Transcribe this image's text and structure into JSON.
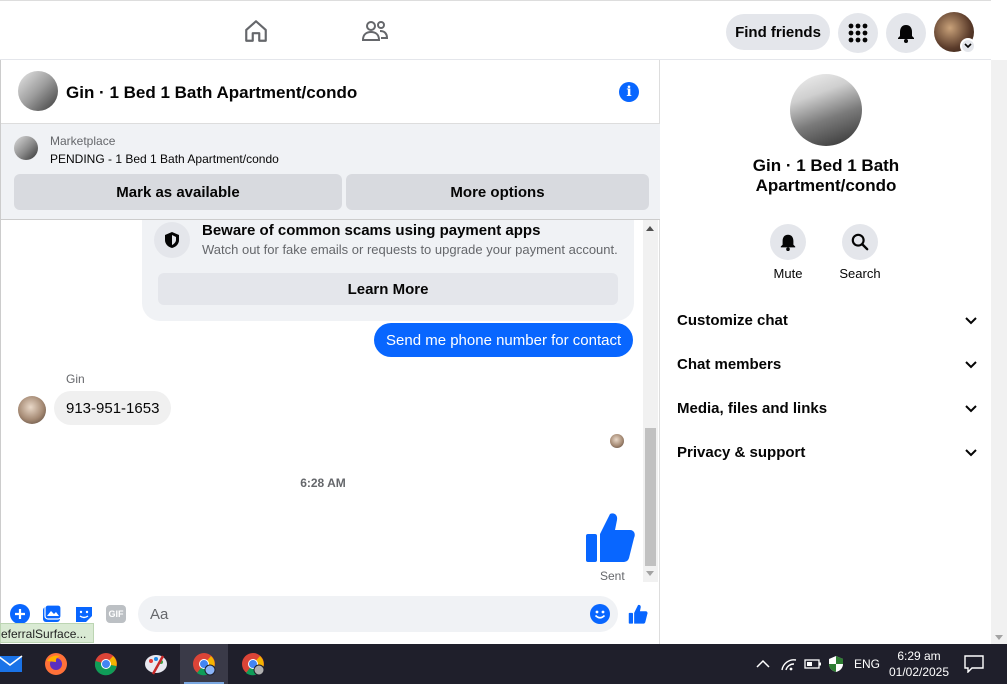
{
  "topnav": {
    "find_friends": "Find friends",
    "icons": [
      "home-icon",
      "friends-icon",
      "menu-grid-icon",
      "bell-icon",
      "profile-avatar"
    ]
  },
  "chat": {
    "title": "Gin · 1 Bed 1 Bath Apartment/condo",
    "marketplace_label": "Marketplace",
    "listing_status": "PENDING - 1 Bed 1 Bath Apartment/condo",
    "mark_available": "Mark as available",
    "more_options": "More options",
    "scam_title": "Beware of common scams using payment apps",
    "scam_body": "Watch out for fake emails or requests to upgrade your payment account.",
    "learn_more": "Learn More",
    "sent_message": "Send me phone number for contact",
    "sender_name": "Gin",
    "received_message": "913-951-1653",
    "timestamp": "6:28 AM",
    "sent_status": "Sent",
    "composer_placeholder": "Aa",
    "gif_label": "GIF"
  },
  "status_link": "eferralSurface...",
  "info_panel": {
    "title": "Gin · 1 Bed 1 Bath Apartment/condo",
    "mute": "Mute",
    "search": "Search",
    "sections": [
      "Customize chat",
      "Chat members",
      "Media, files and links",
      "Privacy & support"
    ]
  },
  "taskbar": {
    "language": "ENG",
    "time": "6:29 am",
    "date": "01/02/2025"
  },
  "colors": {
    "accent": "#0866ff",
    "bubble_grey": "#f0f0f0",
    "taskbar": "#1f1f2b"
  }
}
